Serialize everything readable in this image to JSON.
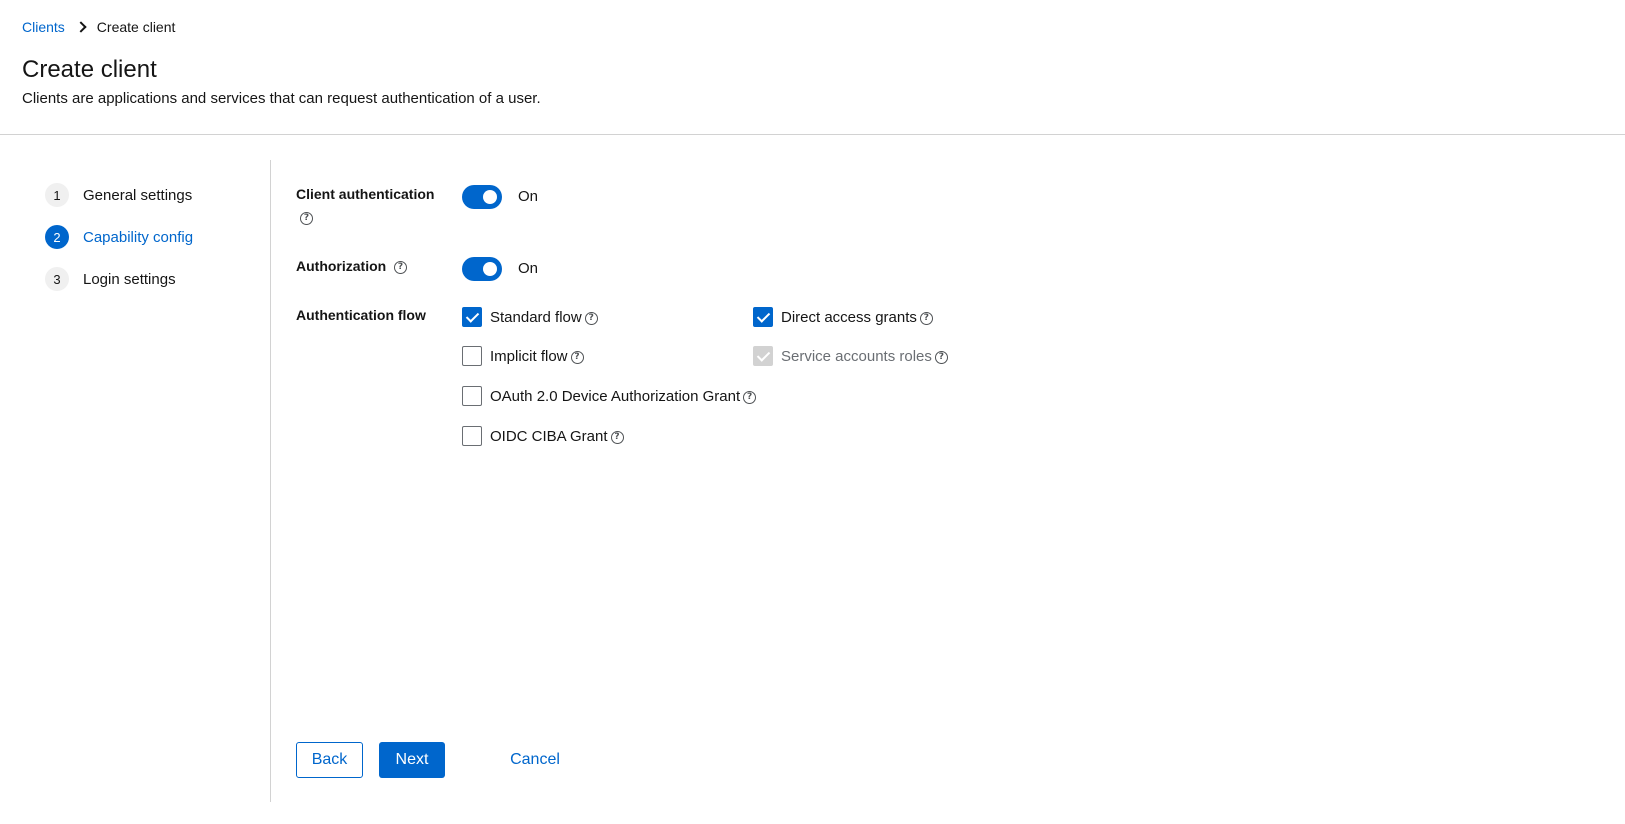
{
  "breadcrumb": {
    "parent": "Clients",
    "current": "Create client"
  },
  "header": {
    "title": "Create client",
    "description": "Clients are applications and services that can request authentication of a user."
  },
  "wizard": {
    "steps": [
      {
        "number": "1",
        "label": "General settings",
        "active": false
      },
      {
        "number": "2",
        "label": "Capability config",
        "active": true
      },
      {
        "number": "3",
        "label": "Login settings",
        "active": false
      }
    ]
  },
  "form": {
    "client_authentication": {
      "label": "Client authentication",
      "state": "On"
    },
    "authorization": {
      "label": "Authorization",
      "state": "On"
    },
    "authentication_flow": {
      "label": "Authentication flow",
      "options": [
        {
          "label": "Standard flow",
          "checked": true,
          "disabled": false
        },
        {
          "label": "Direct access grants",
          "checked": true,
          "disabled": false
        },
        {
          "label": "Implicit flow",
          "checked": false,
          "disabled": false
        },
        {
          "label": "Service accounts roles",
          "checked": true,
          "disabled": true
        },
        {
          "label": "OAuth 2.0 Device Authorization Grant",
          "checked": false,
          "disabled": false
        },
        {
          "label": "OIDC CIBA Grant",
          "checked": false,
          "disabled": false
        }
      ]
    },
    "help_glyph": "?"
  },
  "actions": {
    "back": "Back",
    "next": "Next",
    "cancel": "Cancel"
  },
  "colors": {
    "accent": "#0066cc",
    "text": "#151515",
    "disabled": "#d2d2d2"
  }
}
